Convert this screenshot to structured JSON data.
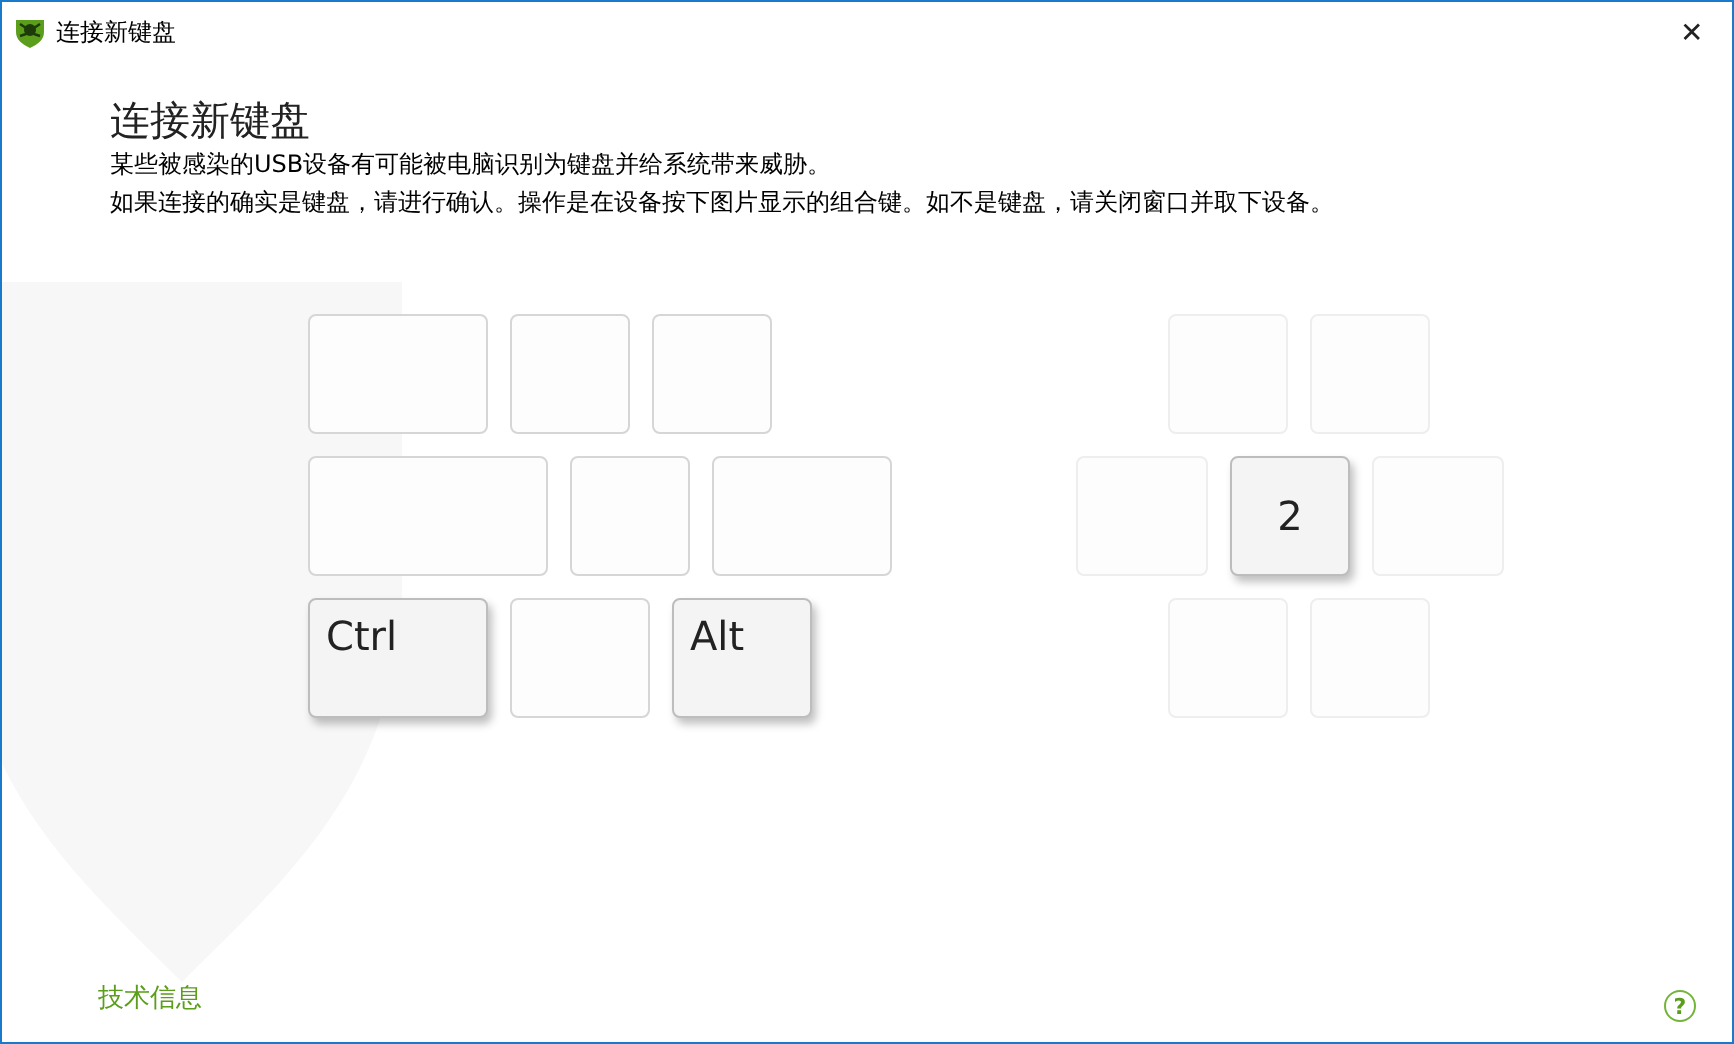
{
  "window": {
    "title": "连接新键盘",
    "close": "✕"
  },
  "heading": "连接新键盘",
  "paragraphs": [
    "某些被感染的USB设备有可能被电脑识别为键盘并给系统带来威胁。",
    "如果连接的确实是键盘，请进行确认。操作是在设备按下图片显示的组合键。如不是键盘，请关闭窗口并取下设备。"
  ],
  "keyboard_left": [
    [
      {
        "pressed": false
      },
      {
        "pressed": false
      },
      {
        "pressed": false
      }
    ],
    [
      {
        "pressed": false
      },
      {
        "pressed": false
      },
      {
        "pressed": false
      }
    ],
    [
      {
        "label": "Ctrl",
        "pressed": true
      },
      {
        "pressed": false
      },
      {
        "label": "Alt",
        "pressed": true
      }
    ]
  ],
  "keyboard_right": [
    [
      {
        "pressed": false
      },
      {
        "pressed": false
      }
    ],
    [
      {
        "pressed": false
      },
      {
        "label": "2",
        "pressed": true
      },
      {
        "pressed": false
      }
    ],
    [
      {
        "pressed": false
      },
      {
        "pressed": false
      }
    ]
  ],
  "footer": {
    "link": "技术信息",
    "help": "?"
  }
}
